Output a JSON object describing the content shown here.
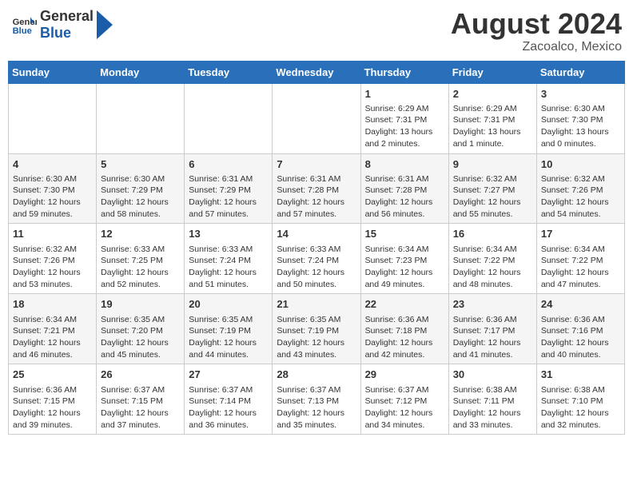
{
  "header": {
    "logo_line1": "General",
    "logo_line2": "Blue",
    "month_year": "August 2024",
    "location": "Zacoalco, Mexico"
  },
  "days_of_week": [
    "Sunday",
    "Monday",
    "Tuesday",
    "Wednesday",
    "Thursday",
    "Friday",
    "Saturday"
  ],
  "weeks": [
    [
      {
        "day": "",
        "content": ""
      },
      {
        "day": "",
        "content": ""
      },
      {
        "day": "",
        "content": ""
      },
      {
        "day": "",
        "content": ""
      },
      {
        "day": "1",
        "content": "Sunrise: 6:29 AM\nSunset: 7:31 PM\nDaylight: 13 hours\nand 2 minutes."
      },
      {
        "day": "2",
        "content": "Sunrise: 6:29 AM\nSunset: 7:31 PM\nDaylight: 13 hours\nand 1 minute."
      },
      {
        "day": "3",
        "content": "Sunrise: 6:30 AM\nSunset: 7:30 PM\nDaylight: 13 hours\nand 0 minutes."
      }
    ],
    [
      {
        "day": "4",
        "content": "Sunrise: 6:30 AM\nSunset: 7:30 PM\nDaylight: 12 hours\nand 59 minutes."
      },
      {
        "day": "5",
        "content": "Sunrise: 6:30 AM\nSunset: 7:29 PM\nDaylight: 12 hours\nand 58 minutes."
      },
      {
        "day": "6",
        "content": "Sunrise: 6:31 AM\nSunset: 7:29 PM\nDaylight: 12 hours\nand 57 minutes."
      },
      {
        "day": "7",
        "content": "Sunrise: 6:31 AM\nSunset: 7:28 PM\nDaylight: 12 hours\nand 57 minutes."
      },
      {
        "day": "8",
        "content": "Sunrise: 6:31 AM\nSunset: 7:28 PM\nDaylight: 12 hours\nand 56 minutes."
      },
      {
        "day": "9",
        "content": "Sunrise: 6:32 AM\nSunset: 7:27 PM\nDaylight: 12 hours\nand 55 minutes."
      },
      {
        "day": "10",
        "content": "Sunrise: 6:32 AM\nSunset: 7:26 PM\nDaylight: 12 hours\nand 54 minutes."
      }
    ],
    [
      {
        "day": "11",
        "content": "Sunrise: 6:32 AM\nSunset: 7:26 PM\nDaylight: 12 hours\nand 53 minutes."
      },
      {
        "day": "12",
        "content": "Sunrise: 6:33 AM\nSunset: 7:25 PM\nDaylight: 12 hours\nand 52 minutes."
      },
      {
        "day": "13",
        "content": "Sunrise: 6:33 AM\nSunset: 7:24 PM\nDaylight: 12 hours\nand 51 minutes."
      },
      {
        "day": "14",
        "content": "Sunrise: 6:33 AM\nSunset: 7:24 PM\nDaylight: 12 hours\nand 50 minutes."
      },
      {
        "day": "15",
        "content": "Sunrise: 6:34 AM\nSunset: 7:23 PM\nDaylight: 12 hours\nand 49 minutes."
      },
      {
        "day": "16",
        "content": "Sunrise: 6:34 AM\nSunset: 7:22 PM\nDaylight: 12 hours\nand 48 minutes."
      },
      {
        "day": "17",
        "content": "Sunrise: 6:34 AM\nSunset: 7:22 PM\nDaylight: 12 hours\nand 47 minutes."
      }
    ],
    [
      {
        "day": "18",
        "content": "Sunrise: 6:34 AM\nSunset: 7:21 PM\nDaylight: 12 hours\nand 46 minutes."
      },
      {
        "day": "19",
        "content": "Sunrise: 6:35 AM\nSunset: 7:20 PM\nDaylight: 12 hours\nand 45 minutes."
      },
      {
        "day": "20",
        "content": "Sunrise: 6:35 AM\nSunset: 7:19 PM\nDaylight: 12 hours\nand 44 minutes."
      },
      {
        "day": "21",
        "content": "Sunrise: 6:35 AM\nSunset: 7:19 PM\nDaylight: 12 hours\nand 43 minutes."
      },
      {
        "day": "22",
        "content": "Sunrise: 6:36 AM\nSunset: 7:18 PM\nDaylight: 12 hours\nand 42 minutes."
      },
      {
        "day": "23",
        "content": "Sunrise: 6:36 AM\nSunset: 7:17 PM\nDaylight: 12 hours\nand 41 minutes."
      },
      {
        "day": "24",
        "content": "Sunrise: 6:36 AM\nSunset: 7:16 PM\nDaylight: 12 hours\nand 40 minutes."
      }
    ],
    [
      {
        "day": "25",
        "content": "Sunrise: 6:36 AM\nSunset: 7:15 PM\nDaylight: 12 hours\nand 39 minutes."
      },
      {
        "day": "26",
        "content": "Sunrise: 6:37 AM\nSunset: 7:15 PM\nDaylight: 12 hours\nand 37 minutes."
      },
      {
        "day": "27",
        "content": "Sunrise: 6:37 AM\nSunset: 7:14 PM\nDaylight: 12 hours\nand 36 minutes."
      },
      {
        "day": "28",
        "content": "Sunrise: 6:37 AM\nSunset: 7:13 PM\nDaylight: 12 hours\nand 35 minutes."
      },
      {
        "day": "29",
        "content": "Sunrise: 6:37 AM\nSunset: 7:12 PM\nDaylight: 12 hours\nand 34 minutes."
      },
      {
        "day": "30",
        "content": "Sunrise: 6:38 AM\nSunset: 7:11 PM\nDaylight: 12 hours\nand 33 minutes."
      },
      {
        "day": "31",
        "content": "Sunrise: 6:38 AM\nSunset: 7:10 PM\nDaylight: 12 hours\nand 32 minutes."
      }
    ]
  ]
}
